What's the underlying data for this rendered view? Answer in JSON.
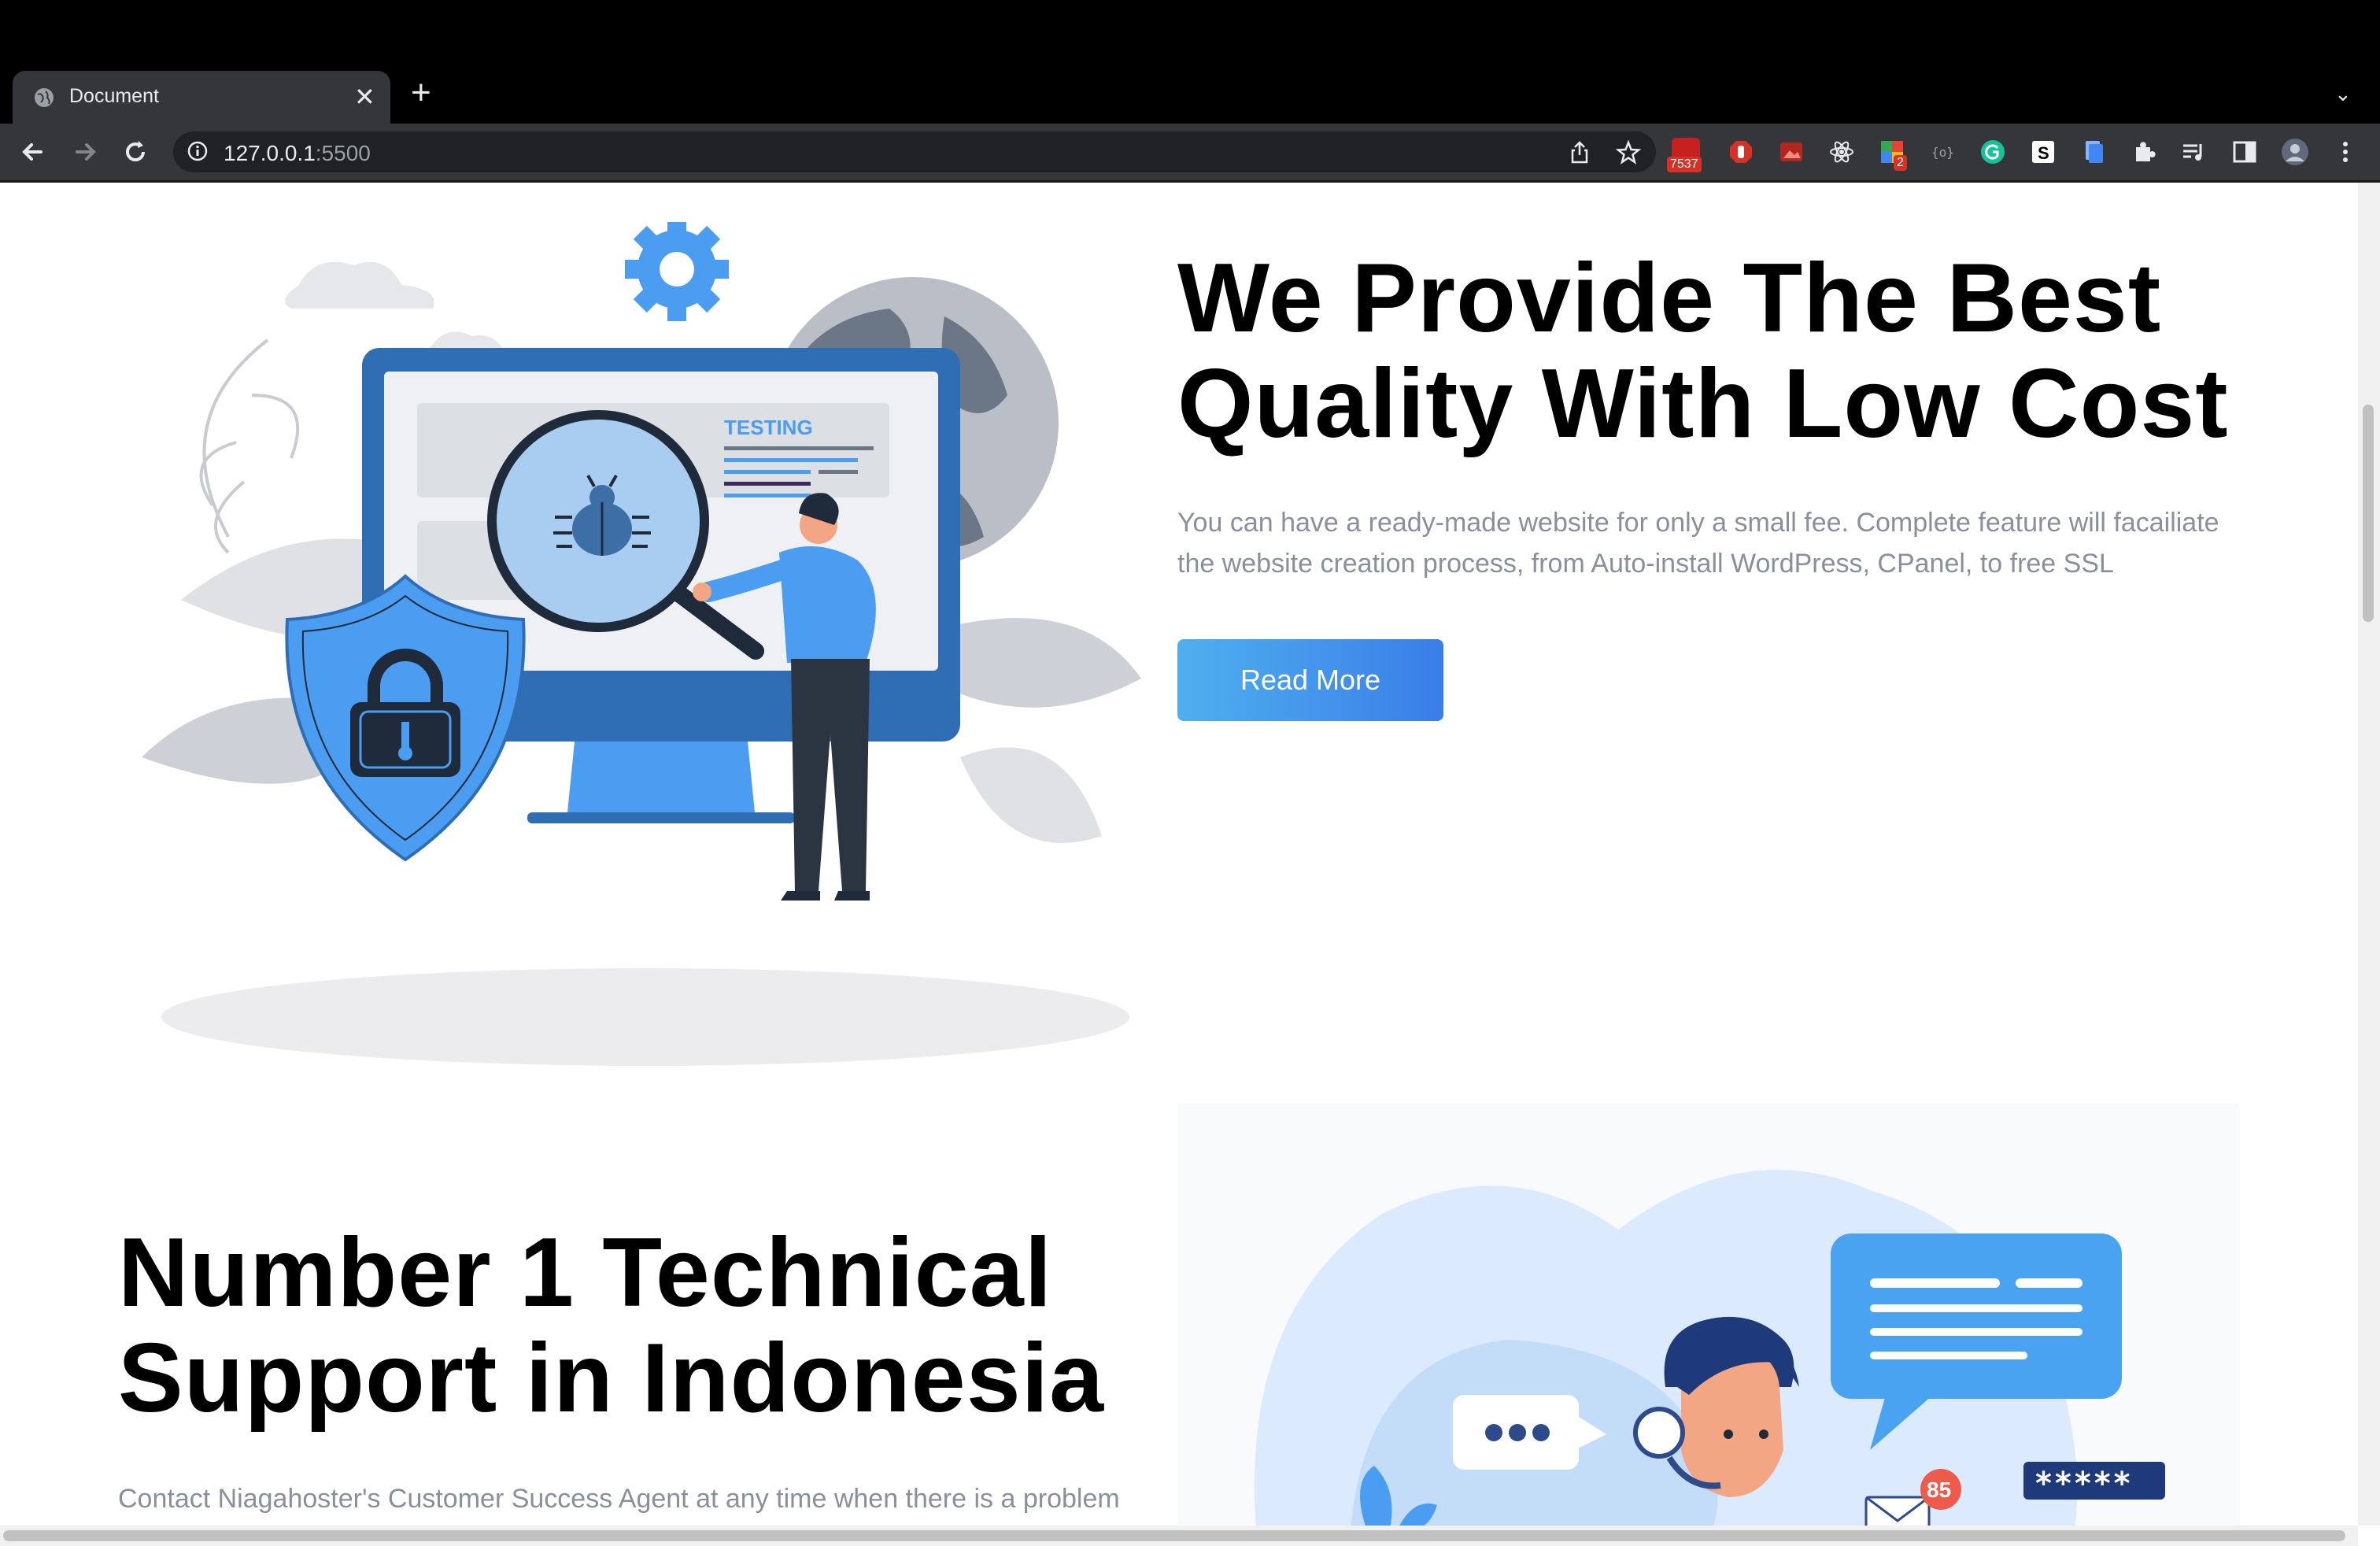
{
  "browser": {
    "tab_title": "Document",
    "tab_close": "✕",
    "new_tab": "+",
    "tab_menu": "⌄",
    "url_host": "127.0.0.1",
    "url_port": ":5500",
    "mail_badge": "7537",
    "ext_badge": "2",
    "icons": [
      "back-icon",
      "forward-icon",
      "reload-icon",
      "info-icon",
      "share-icon",
      "star-icon",
      "extensions-icon",
      "profile-icon",
      "menu-icon"
    ]
  },
  "hero": {
    "title_line1": "We Provide The Best",
    "title_line2": "Quality With Low Cost",
    "desc_line1": "You can have a ready-made website for only a small fee. Complete feature will facailiate",
    "desc_line2": "the website creation process, from Auto-install WordPress, CPanel, to free SSL",
    "button_label": "Read More",
    "illustration_label": "TESTING"
  },
  "support": {
    "title_line1": "Number 1 Technical",
    "title_line2": "Support in Indonesia",
    "desc_line1": "Contact Niagahoster's Customer Success Agent at any time when there is a problem",
    "notification_count": "85",
    "password_mask": "*****"
  },
  "colors": {
    "accent_blue": "#4a9df0",
    "dark_blue": "#2f6db5",
    "text_gray": "#8a8f9c"
  }
}
